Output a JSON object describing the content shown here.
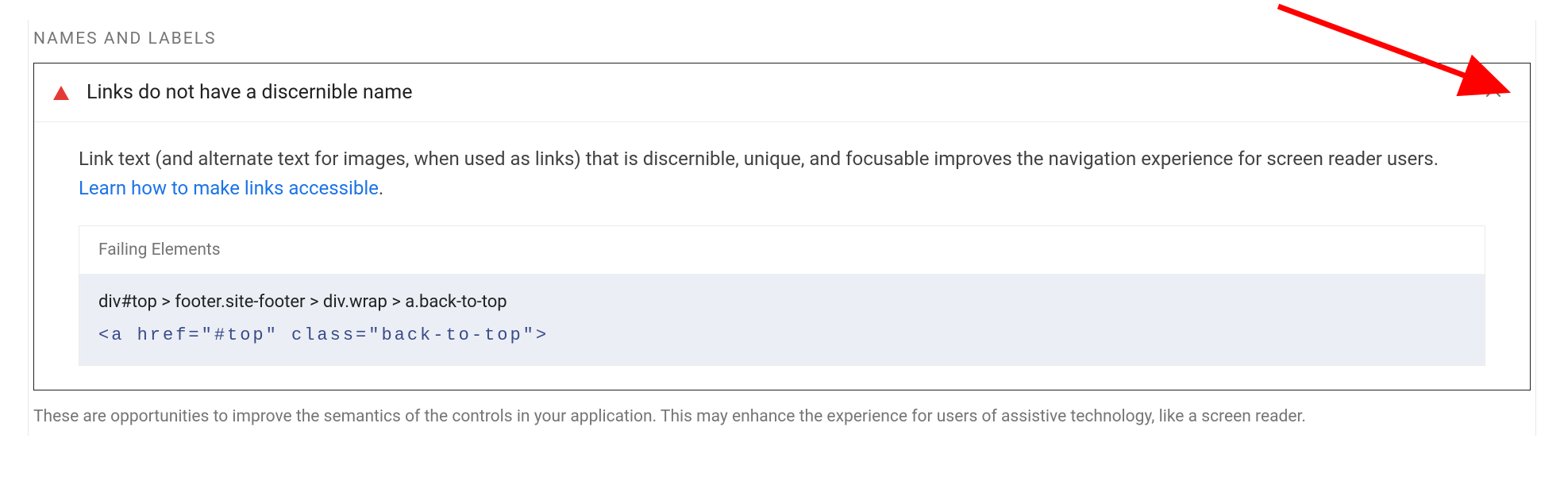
{
  "section_title": "NAMES AND LABELS",
  "audit": {
    "title": "Links do not have a discernible name",
    "description_pre": "Link text (and alternate text for images, when used as links) that is discernible, unique, and focusable improves the navigation experience for screen reader users. ",
    "learn_link": "Learn how to make links accessible",
    "period": "."
  },
  "failing": {
    "header": "Failing Elements",
    "selector": "div#top > footer.site-footer > div.wrap > a.back-to-top",
    "snippet": "<a href=\"#top\" class=\"back-to-top\">"
  },
  "footer_note": "These are opportunities to improve the semantics of the controls in your application. This may enhance the experience for users of assistive technology, like a screen reader."
}
